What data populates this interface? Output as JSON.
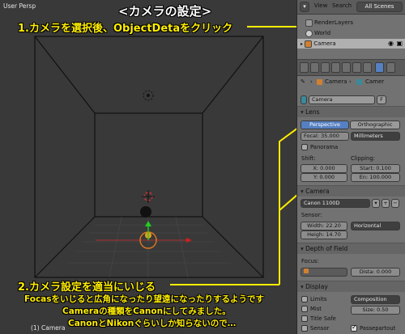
{
  "viewport": {
    "view_title": "User Persp",
    "object_label": "(1) Camera"
  },
  "annotations": {
    "heading": "<カメラの設定>",
    "step1": "1.カメラを選択後、ObjectDetaをクリック",
    "step2": "2.カメラ設定を適当にいじる",
    "note1": "Focasをいじると広角になったり望遠になったりするようです",
    "note2": "Cameraの種類をCanonにしてみました。",
    "note3": "CanonとNikonぐらいしか知らないので…"
  },
  "header": {
    "view": "View",
    "search": "Search",
    "scenes": "All Scenes"
  },
  "outliner": {
    "items": [
      {
        "label": "RenderLayers"
      },
      {
        "label": "World"
      },
      {
        "label": "Camera"
      }
    ]
  },
  "breadcrumb": {
    "item1": "Camera",
    "item2": "Camer"
  },
  "datablock": {
    "name": "Camera",
    "fake_user": "F"
  },
  "lens": {
    "section": "Lens",
    "perspective": "Perspective",
    "orthographic": "Orthographic",
    "focal_label": "Focal:",
    "focal_value": "35.000",
    "units": "Millimeters",
    "panorama": "Panorama",
    "shift_label": "Shift:",
    "shift_x_label": "X:",
    "shift_x_value": "0.000",
    "shift_y_label": "Y:",
    "shift_y_value": "0.000",
    "clipping_label": "Clipping:",
    "clip_start_label": "Start:",
    "clip_start_value": "0.100",
    "clip_end_label": "En:",
    "clip_end_value": "100.000"
  },
  "camera": {
    "section": "Camera",
    "preset": "Canon 1100D",
    "sensor_label": "Sensor:",
    "width_label": "Width:",
    "width_value": "22.20",
    "height_label": "Heigh:",
    "height_value": "14.70",
    "fit": "Horizontal"
  },
  "dof": {
    "section": "Depth of Field",
    "focus_label": "Focus:",
    "distance_label": "Dista:",
    "distance_value": "0.000"
  },
  "display": {
    "section": "Display",
    "limits": "Limits",
    "mist": "Mist",
    "title_safe": "Title Safe",
    "sensor": "Sensor",
    "composition": "Composition",
    "size_label": "Size:",
    "size_value": "0.50",
    "passepartout": "Passepartout"
  },
  "colors": {
    "panel_bg": "#727272",
    "viewport_bg": "#393939",
    "accent_blue": "#5680c2",
    "annotation_yellow": "#ffee00"
  }
}
